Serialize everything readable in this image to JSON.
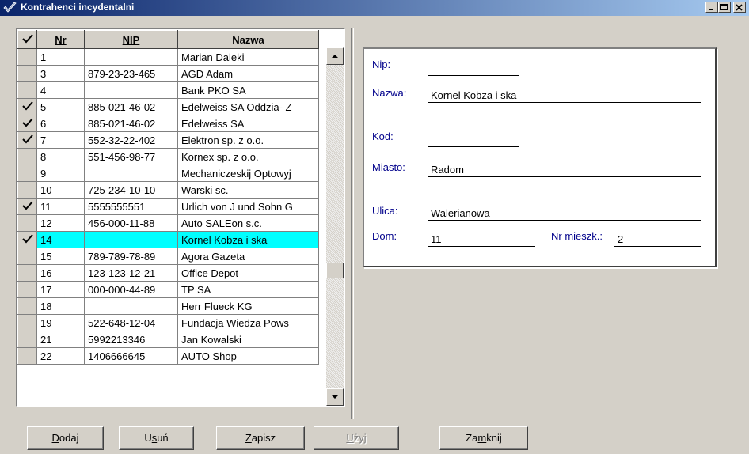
{
  "window": {
    "title": "Kontrahenci incydentalni"
  },
  "grid": {
    "headers": {
      "nr": "Nr",
      "nip": "NIP",
      "nazwa": "Nazwa"
    },
    "rows": [
      {
        "checked": false,
        "nr": "1",
        "nip": "",
        "nazwa": "Marian Daleki"
      },
      {
        "checked": false,
        "nr": "3",
        "nip": "879-23-23-465",
        "nazwa": "AGD Adam"
      },
      {
        "checked": false,
        "nr": "4",
        "nip": "",
        "nazwa": "Bank PKO SA"
      },
      {
        "checked": true,
        "nr": "5",
        "nip": "885-021-46-02",
        "nazwa": "Edelweiss SA Oddzia- Z"
      },
      {
        "checked": true,
        "nr": "6",
        "nip": "885-021-46-02",
        "nazwa": "Edelweiss SA"
      },
      {
        "checked": true,
        "nr": "7",
        "nip": "552-32-22-402",
        "nazwa": "Elektron sp. z o.o."
      },
      {
        "checked": false,
        "nr": "8",
        "nip": "551-456-98-77",
        "nazwa": "Kornex sp. z o.o."
      },
      {
        "checked": false,
        "nr": "9",
        "nip": "",
        "nazwa": "Mechaniczeskij Optowyj"
      },
      {
        "checked": false,
        "nr": "10",
        "nip": "725-234-10-10",
        "nazwa": "Warski sc."
      },
      {
        "checked": true,
        "nr": "11",
        "nip": "5555555551",
        "nazwa": "Urlich von J und Sohn G"
      },
      {
        "checked": false,
        "nr": "12",
        "nip": "456-000-11-88",
        "nazwa": "Auto SALEon s.c."
      },
      {
        "checked": true,
        "nr": "14",
        "nip": "",
        "nazwa": "Kornel Kobza i ska",
        "selected": true
      },
      {
        "checked": false,
        "nr": "15",
        "nip": "789-789-78-89",
        "nazwa": "Agora Gazeta"
      },
      {
        "checked": false,
        "nr": "16",
        "nip": "123-123-12-21",
        "nazwa": "Office Depot"
      },
      {
        "checked": false,
        "nr": "17",
        "nip": "000-000-44-89",
        "nazwa": "TP SA"
      },
      {
        "checked": false,
        "nr": "18",
        "nip": "",
        "nazwa": "Herr Flueck KG"
      },
      {
        "checked": false,
        "nr": "19",
        "nip": "522-648-12-04",
        "nazwa": "Fundacja Wiedza Pows"
      },
      {
        "checked": false,
        "nr": "21",
        "nip": "5992213346",
        "nazwa": "Jan Kowalski"
      },
      {
        "checked": false,
        "nr": "22",
        "nip": "1406666645",
        "nazwa": "AUTO Shop"
      }
    ]
  },
  "details": {
    "nip_label": "Nip:",
    "nip_value": "",
    "nazwa_label": "Nazwa:",
    "nazwa_value": "Kornel Kobza i ska",
    "kod_label": "Kod:",
    "kod_value": "",
    "miasto_label": "Miasto:",
    "miasto_value": "Radom",
    "ulica_label": "Ulica:",
    "ulica_value": "Walerianowa",
    "dom_label": "Dom:",
    "dom_value": "11",
    "nr_mieszk_label": "Nr mieszk.:",
    "nr_mieszk_value": "2"
  },
  "buttons": {
    "dodaj": {
      "pre": "",
      "ul": "D",
      "post": "odaj"
    },
    "usun": {
      "pre": "U",
      "ul": "s",
      "post": "uń"
    },
    "zapisz": {
      "pre": "",
      "ul": "Z",
      "post": "apisz"
    },
    "uzyj": {
      "pre": "",
      "ul": "U",
      "post": "żyj"
    },
    "zamknij": {
      "pre": "Za",
      "ul": "m",
      "post": "knij"
    }
  },
  "colors": {
    "title_bar": "#0a246a",
    "selected_row": "#00ffff",
    "label_text": "#00008b"
  },
  "icons": {
    "window": "checkmark-icon",
    "row_check": "checkmark-icon"
  }
}
